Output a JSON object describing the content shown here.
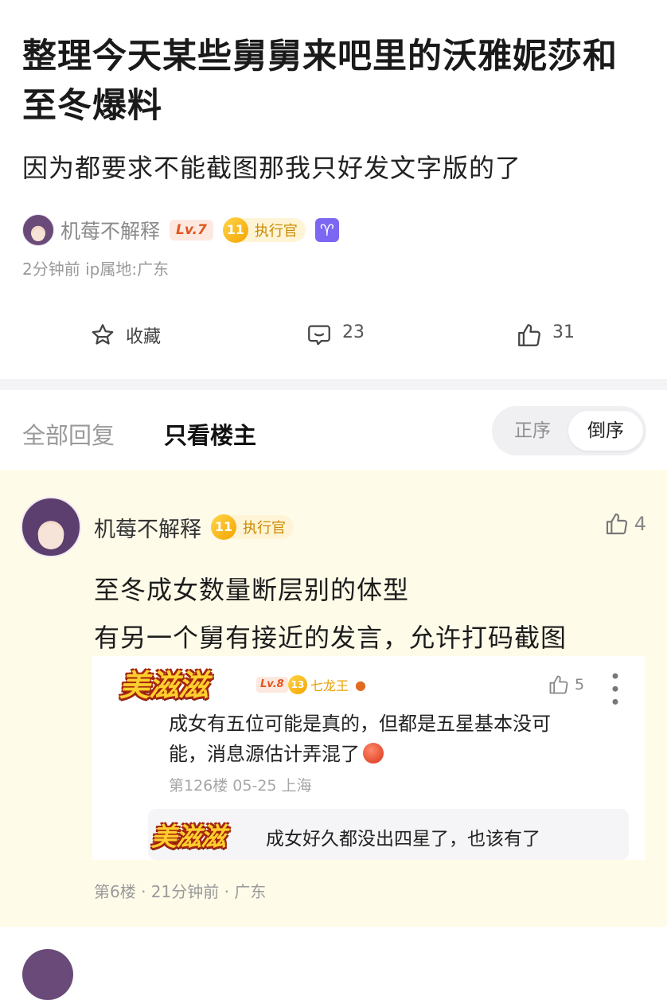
{
  "post": {
    "title": "整理今天某些舅舅来吧里的沃雅妮莎和至冬爆料",
    "subtitle": "因为都要求不能截图那我只好发文字版的了",
    "author": {
      "name": "机莓不解释",
      "level": "Lv.7",
      "rank_num": "11",
      "rank_label": "执行官",
      "zodiac_glyph": "♈"
    },
    "meta": "2分钟前  ip属地:广东",
    "actions": {
      "favorite_label": "收藏",
      "comment_count": "23",
      "like_count": "31"
    }
  },
  "filter": {
    "tabs": [
      "全部回复",
      "只看楼主"
    ],
    "sort_options": [
      "正序",
      "倒序"
    ],
    "sort_selected": "倒序"
  },
  "reply": {
    "author": "机莓不解释",
    "rank_num": "11",
    "rank_label": "执行官",
    "like_count": "4",
    "lines": [
      "至冬成女数量断层别的体型",
      "有另一个舅有接近的发言，允许打码截图"
    ],
    "quote": {
      "logo_text": "美滋滋",
      "level": "Lv.8",
      "rank_num": "13",
      "rank_label": "七龙王",
      "like_count": "5",
      "text_line1": "成女有五位可能是真的，但都是五星基本没可",
      "text_line2": "能，消息源估计弄混了",
      "meta": "第126楼 05-25 上海",
      "sub_reply_logo": "美滋滋",
      "sub_reply_text": "成女好久都没出四星了，也该有了"
    },
    "meta": "第6楼 · 21分钟前 · 广东"
  },
  "colors": {
    "reply_bg": "#fffbe9",
    "level_badge": "#e0561f",
    "rank_badge": "#f5a400",
    "zodiac_badge": "#7b67f2"
  }
}
